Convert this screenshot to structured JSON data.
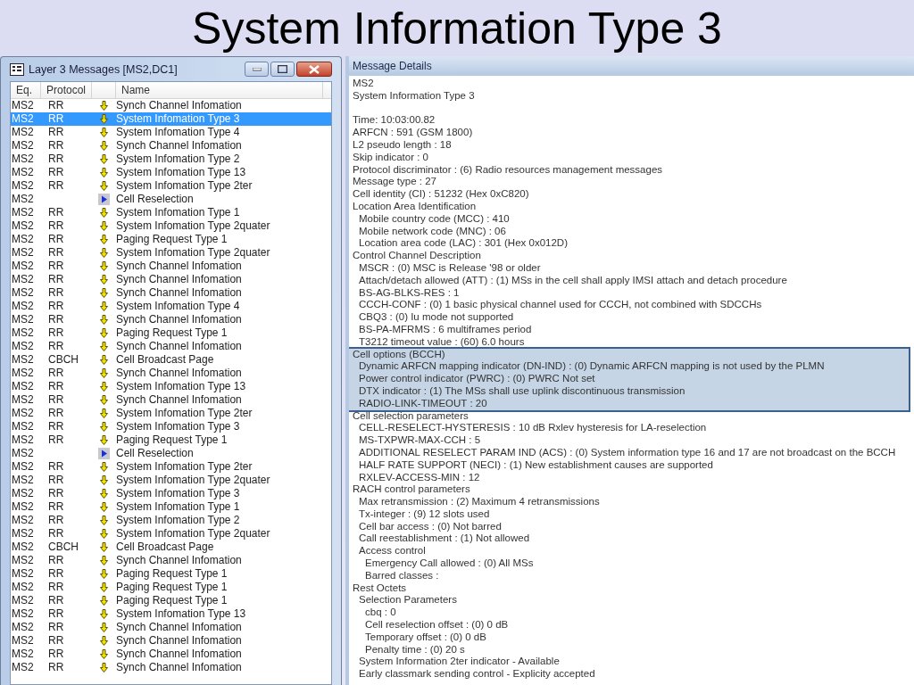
{
  "slide_title": "System Information Type 3",
  "messages_window": {
    "title": "Layer 3 Messages  [MS2,DC1]",
    "columns": [
      "Eq.",
      "Protocol",
      "Name"
    ],
    "rows": [
      {
        "eq": "MS2",
        "protocol": "RR",
        "kind": "down",
        "name": "Synch Channel Infomation",
        "selected": false
      },
      {
        "eq": "MS2",
        "protocol": "RR",
        "kind": "down",
        "name": "System Infomation Type 3",
        "selected": true
      },
      {
        "eq": "MS2",
        "protocol": "RR",
        "kind": "down",
        "name": "System Infomation Type 4",
        "selected": false
      },
      {
        "eq": "MS2",
        "protocol": "RR",
        "kind": "down",
        "name": "Synch Channel Infomation",
        "selected": false
      },
      {
        "eq": "MS2",
        "protocol": "RR",
        "kind": "down",
        "name": "System Infomation Type 2",
        "selected": false
      },
      {
        "eq": "MS2",
        "protocol": "RR",
        "kind": "down",
        "name": "System Infomation Type 13",
        "selected": false
      },
      {
        "eq": "MS2",
        "protocol": "RR",
        "kind": "down",
        "name": "System Infomation Type 2ter",
        "selected": false
      },
      {
        "eq": "MS2",
        "kind": "event",
        "name": "Cell Reselection",
        "selected": false
      },
      {
        "eq": "MS2",
        "protocol": "RR",
        "kind": "down",
        "name": "System Infomation Type 1",
        "selected": false
      },
      {
        "eq": "MS2",
        "protocol": "RR",
        "kind": "down",
        "name": "System Infomation Type 2quater",
        "selected": false
      },
      {
        "eq": "MS2",
        "protocol": "RR",
        "kind": "down",
        "name": "Paging Request Type 1",
        "selected": false
      },
      {
        "eq": "MS2",
        "protocol": "RR",
        "kind": "down",
        "name": "System Infomation Type 2quater",
        "selected": false
      },
      {
        "eq": "MS2",
        "protocol": "RR",
        "kind": "down",
        "name": "Synch Channel Infomation",
        "selected": false
      },
      {
        "eq": "MS2",
        "protocol": "RR",
        "kind": "down",
        "name": "Synch Channel Infomation",
        "selected": false
      },
      {
        "eq": "MS2",
        "protocol": "RR",
        "kind": "down",
        "name": "Synch Channel Infomation",
        "selected": false
      },
      {
        "eq": "MS2",
        "protocol": "RR",
        "kind": "down",
        "name": "System Infomation Type 4",
        "selected": false
      },
      {
        "eq": "MS2",
        "protocol": "RR",
        "kind": "down",
        "name": "Synch Channel Infomation",
        "selected": false
      },
      {
        "eq": "MS2",
        "protocol": "RR",
        "kind": "down",
        "name": "Paging Request Type 1",
        "selected": false
      },
      {
        "eq": "MS2",
        "protocol": "RR",
        "kind": "down",
        "name": "Synch Channel Infomation",
        "selected": false
      },
      {
        "eq": "MS2",
        "protocol": "CBCH",
        "kind": "down",
        "name": "Cell Broadcast Page",
        "selected": false
      },
      {
        "eq": "MS2",
        "protocol": "RR",
        "kind": "down",
        "name": "Synch Channel Infomation",
        "selected": false
      },
      {
        "eq": "MS2",
        "protocol": "RR",
        "kind": "down",
        "name": "System Infomation Type 13",
        "selected": false
      },
      {
        "eq": "MS2",
        "protocol": "RR",
        "kind": "down",
        "name": "Synch Channel Infomation",
        "selected": false
      },
      {
        "eq": "MS2",
        "protocol": "RR",
        "kind": "down",
        "name": "System Infomation Type 2ter",
        "selected": false
      },
      {
        "eq": "MS2",
        "protocol": "RR",
        "kind": "down",
        "name": "System Infomation Type 3",
        "selected": false
      },
      {
        "eq": "MS2",
        "protocol": "RR",
        "kind": "down",
        "name": "Paging Request Type 1",
        "selected": false
      },
      {
        "eq": "MS2",
        "kind": "event",
        "name": "Cell Reselection",
        "selected": false
      },
      {
        "eq": "MS2",
        "protocol": "RR",
        "kind": "down",
        "name": "System Infomation Type 2ter",
        "selected": false
      },
      {
        "eq": "MS2",
        "protocol": "RR",
        "kind": "down",
        "name": "System Infomation Type 2quater",
        "selected": false
      },
      {
        "eq": "MS2",
        "protocol": "RR",
        "kind": "down",
        "name": "System Infomation Type 3",
        "selected": false
      },
      {
        "eq": "MS2",
        "protocol": "RR",
        "kind": "down",
        "name": "System Infomation Type 1",
        "selected": false
      },
      {
        "eq": "MS2",
        "protocol": "RR",
        "kind": "down",
        "name": "System Infomation Type 2",
        "selected": false
      },
      {
        "eq": "MS2",
        "protocol": "RR",
        "kind": "down",
        "name": "System Infomation Type 2quater",
        "selected": false
      },
      {
        "eq": "MS2",
        "protocol": "CBCH",
        "kind": "down",
        "name": "Cell Broadcast Page",
        "selected": false
      },
      {
        "eq": "MS2",
        "protocol": "RR",
        "kind": "down",
        "name": "Synch Channel Infomation",
        "selected": false
      },
      {
        "eq": "MS2",
        "protocol": "RR",
        "kind": "down",
        "name": "Paging Request Type 1",
        "selected": false
      },
      {
        "eq": "MS2",
        "protocol": "RR",
        "kind": "down",
        "name": "Paging Request Type 1",
        "selected": false
      },
      {
        "eq": "MS2",
        "protocol": "RR",
        "kind": "down",
        "name": "Paging Request Type 1",
        "selected": false
      },
      {
        "eq": "MS2",
        "protocol": "RR",
        "kind": "down",
        "name": "System Infomation Type 13",
        "selected": false
      },
      {
        "eq": "MS2",
        "protocol": "RR",
        "kind": "down",
        "name": "Synch Channel Infomation",
        "selected": false
      },
      {
        "eq": "MS2",
        "protocol": "RR",
        "kind": "down",
        "name": "Synch Channel Infomation",
        "selected": false
      },
      {
        "eq": "MS2",
        "protocol": "RR",
        "kind": "down",
        "name": "Synch Channel Infomation",
        "selected": false
      },
      {
        "eq": "MS2",
        "protocol": "RR",
        "kind": "down",
        "name": "Synch Channel Infomation",
        "selected": false
      }
    ]
  },
  "message_details": {
    "title": "Message Details",
    "header_lines": [
      "MS2",
      "System Information Type 3"
    ],
    "items": [
      {
        "text": "Time: 10:03:00.82",
        "highlighted": false
      },
      {
        "text": "ARFCN : 591 (GSM 1800)",
        "highlighted": false
      },
      {
        "text": "L2 pseudo length : 18",
        "highlighted": false
      },
      {
        "text": "Skip indicator : 0",
        "highlighted": false
      },
      {
        "text": "Protocol discriminator : (6) Radio resources management messages",
        "highlighted": false
      },
      {
        "text": "Message type : 27",
        "highlighted": false
      },
      {
        "text": "Cell identity (CI) : 51232 (Hex 0xC820)",
        "highlighted": false
      },
      {
        "text": "Location Area Identification",
        "highlighted": false,
        "children": [
          {
            "text": "Mobile country code (MCC) : 410"
          },
          {
            "text": "Mobile network code (MNC) : 06"
          },
          {
            "text": "Location area code (LAC) : 301 (Hex 0x012D)"
          }
        ]
      },
      {
        "text": "Control Channel Description",
        "highlighted": false,
        "children": [
          {
            "text": "MSCR : (0) MSC is Release '98 or older"
          },
          {
            "text": "Attach/detach allowed (ATT) : (1) MSs in the cell shall apply IMSI attach and detach procedure"
          },
          {
            "text": "BS-AG-BLKS-RES : 1"
          },
          {
            "text": "CCCH-CONF : (0) 1 basic physical channel used for CCCH, not combined with SDCCHs"
          },
          {
            "text": "CBQ3 : (0) Iu mode not supported"
          },
          {
            "text": "BS-PA-MFRMS : 6 multiframes period"
          },
          {
            "text": "T3212 timeout value : (60) 6.0 hours"
          }
        ]
      },
      {
        "text": "Cell options (BCCH)",
        "highlighted": true,
        "children": [
          {
            "text": "Dynamic ARFCN mapping indicator (DN-IND) : (0) Dynamic ARFCN mapping is not used by the PLMN"
          },
          {
            "text": "Power control indicator (PWRC) : (0) PWRC Not set"
          },
          {
            "text": "DTX indicator : (1) The MSs shall use uplink discontinuous transmission"
          },
          {
            "text": "RADIO-LINK-TIMEOUT : 20"
          }
        ]
      },
      {
        "text": "Cell selection parameters",
        "highlighted": false,
        "children": [
          {
            "text": "CELL-RESELECT-HYSTERESIS : 10 dB Rxlev hysteresis for LA-reselection"
          },
          {
            "text": "MS-TXPWR-MAX-CCH : 5"
          },
          {
            "text": "ADDITIONAL RESELECT PARAM IND (ACS) : (0) System information type 16 and 17 are not broadcast on the BCCH"
          },
          {
            "text": "HALF RATE SUPPORT (NECI) : (1) New establishment causes are supported"
          },
          {
            "text": "RXLEV-ACCESS-MIN : 12"
          }
        ]
      },
      {
        "text": "RACH control parameters",
        "highlighted": false,
        "children": [
          {
            "text": "Max retransmission : (2) Maximum 4 retransmissions"
          },
          {
            "text": "Tx-integer : (9) 12 slots used"
          },
          {
            "text": "Cell bar access : (0) Not barred"
          },
          {
            "text": "Call reestablishment : (1) Not allowed"
          },
          {
            "text": "Access control",
            "children": [
              {
                "text": "Emergency Call allowed : (0) All MSs"
              },
              {
                "text": "Barred classes :"
              }
            ]
          }
        ]
      },
      {
        "text": "Rest Octets",
        "highlighted": false,
        "children": [
          {
            "text": "Selection Parameters",
            "children": [
              {
                "text": "cbq : 0"
              },
              {
                "text": "Cell reselection offset : (0) 0 dB"
              },
              {
                "text": "Temporary offset : (0) 0 dB"
              },
              {
                "text": "Penalty time : (0) 20 s"
              }
            ]
          },
          {
            "text": "System Information 2ter indicator - Available"
          },
          {
            "text": "Early classmark sending control - Explicity accepted"
          }
        ]
      }
    ]
  }
}
